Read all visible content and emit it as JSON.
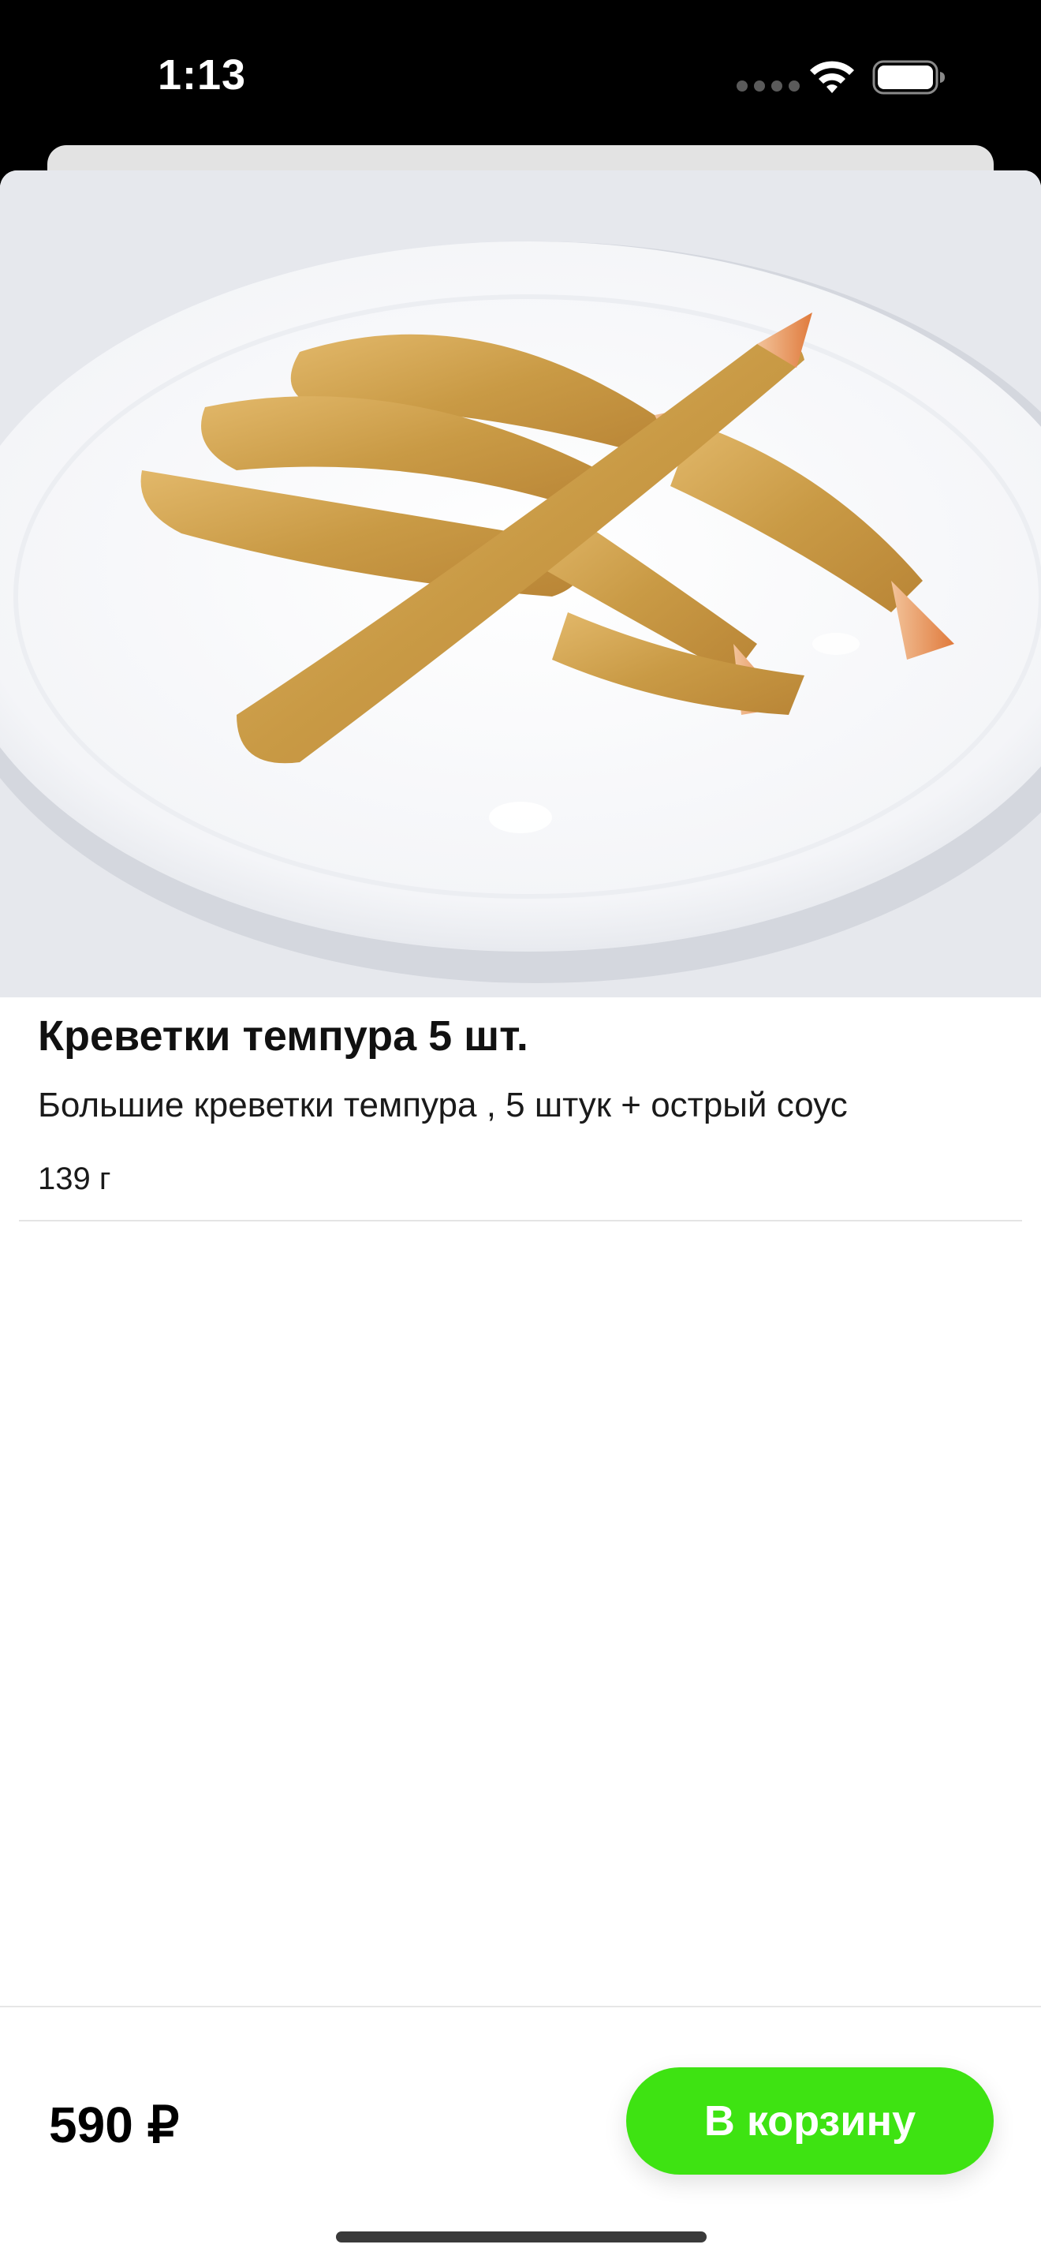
{
  "status_bar": {
    "time": "1:13"
  },
  "product": {
    "title": "Креветки темпура 5 шт.",
    "description": "Большие креветки темпура , 5 штук + острый соус",
    "weight": "139 г"
  },
  "footer": {
    "price": "590 ₽",
    "cart_button_label": "В корзину"
  },
  "colors": {
    "accent": "#3ee312",
    "background": "#ffffff",
    "status_bar": "#000000"
  },
  "icons": [
    "wifi-icon",
    "battery-icon",
    "signal-icon"
  ]
}
